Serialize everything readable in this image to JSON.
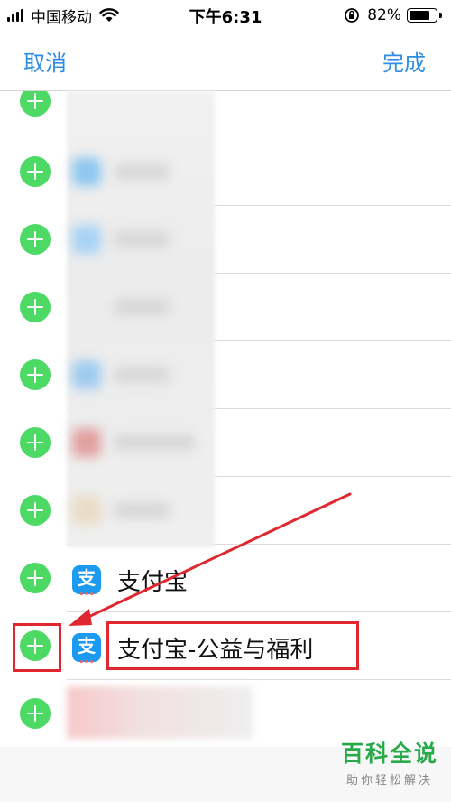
{
  "status_bar": {
    "carrier": "中国移动",
    "time": "下午6:31",
    "battery_percent": "82%",
    "battery_level": 0.82
  },
  "nav": {
    "cancel_label": "取消",
    "done_label": "完成"
  },
  "list": {
    "items": [
      {
        "name": "支付宝",
        "icon": "alipay-icon"
      },
      {
        "name": "支付宝-公益与福利",
        "icon": "alipay-icon"
      }
    ]
  },
  "watermark": {
    "title": "百科全说",
    "subtitle": "助你轻松解决"
  },
  "colors": {
    "accent": "#2f8de4",
    "add_button": "#4cd964",
    "highlight": "#e0262e",
    "alipay": "#1b9af0",
    "watermark": "#2aa94b"
  }
}
